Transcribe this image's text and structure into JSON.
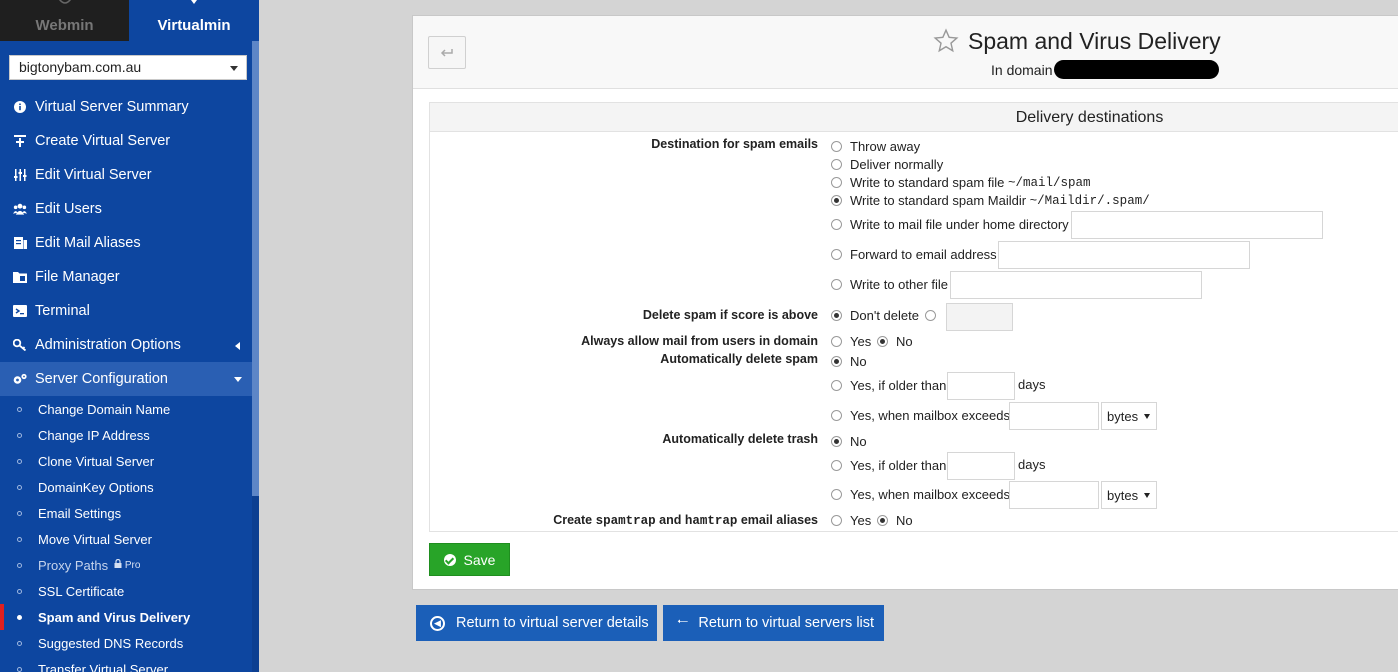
{
  "sidebar": {
    "tabs": {
      "webmin": "Webmin",
      "virtualmin": "Virtualmin"
    },
    "domain_select": "bigtonybam.com.au",
    "items": [
      {
        "label": "Virtual Server Summary",
        "icon": "info-icon"
      },
      {
        "label": "Create Virtual Server",
        "icon": "plus-icon"
      },
      {
        "label": "Edit Virtual Server",
        "icon": "sliders-icon"
      },
      {
        "label": "Edit Users",
        "icon": "users-icon"
      },
      {
        "label": "Edit Mail Aliases",
        "icon": "aliases-icon"
      },
      {
        "label": "File Manager",
        "icon": "folder-icon"
      },
      {
        "label": "Terminal",
        "icon": "terminal-icon"
      },
      {
        "label": "Administration Options",
        "icon": "key-icon"
      },
      {
        "label": "Server Configuration",
        "icon": "gears-icon"
      }
    ],
    "subitems": [
      {
        "label": "Change Domain Name"
      },
      {
        "label": "Change IP Address"
      },
      {
        "label": "Clone Virtual Server"
      },
      {
        "label": "DomainKey Options"
      },
      {
        "label": "Email Settings"
      },
      {
        "label": "Move Virtual Server"
      },
      {
        "label": "Proxy Paths",
        "badge": "Pro"
      },
      {
        "label": "SSL Certificate"
      },
      {
        "label": "Spam and Virus Delivery"
      },
      {
        "label": "Suggested DNS Records"
      },
      {
        "label": "Transfer Virtual Server"
      }
    ]
  },
  "header": {
    "title": "Spam and Virus Delivery",
    "in_domain": "In domain"
  },
  "section": {
    "title": "Delivery destinations",
    "spam_dest": {
      "label": "Destination for spam emails",
      "throw_away": "Throw away",
      "deliver_normally": "Deliver normally",
      "std_file": "Write to standard spam file",
      "std_file_path": "~/mail/spam",
      "std_maildir": "Write to standard spam Maildir",
      "std_maildir_path": "~/Maildir/.spam/",
      "home_file": "Write to mail file under home directory",
      "forward": "Forward to email address",
      "other_file": "Write to other file"
    },
    "delete_score": {
      "label": "Delete spam if score is above",
      "dont_delete": "Don't delete"
    },
    "allow_users": {
      "label": "Always allow mail from users in domain",
      "yes": "Yes",
      "no": "No"
    },
    "auto_spam": {
      "label": "Automatically delete spam",
      "no": "No",
      "older": "Yes, if older than",
      "days": "days",
      "exceeds": "Yes, when mailbox exceeds",
      "unit": "bytes"
    },
    "auto_trash": {
      "label": "Automatically delete trash",
      "no": "No",
      "older": "Yes, if older than",
      "days": "days",
      "exceeds": "Yes, when mailbox exceeds",
      "unit": "bytes"
    },
    "traps": {
      "label_pre": "Create",
      "label_spam": "spamtrap",
      "label_mid": "and",
      "label_ham": "hamtrap",
      "label_post": "email aliases",
      "yes": "Yes",
      "no": "No"
    }
  },
  "buttons": {
    "save": "Save",
    "return_details": "Return to virtual server details",
    "return_list": "Return to virtual servers list"
  },
  "colors": {
    "sidebar": "#0d46a0",
    "save": "#28a428",
    "return": "#1b5fb8",
    "active_marker": "#e02020"
  }
}
